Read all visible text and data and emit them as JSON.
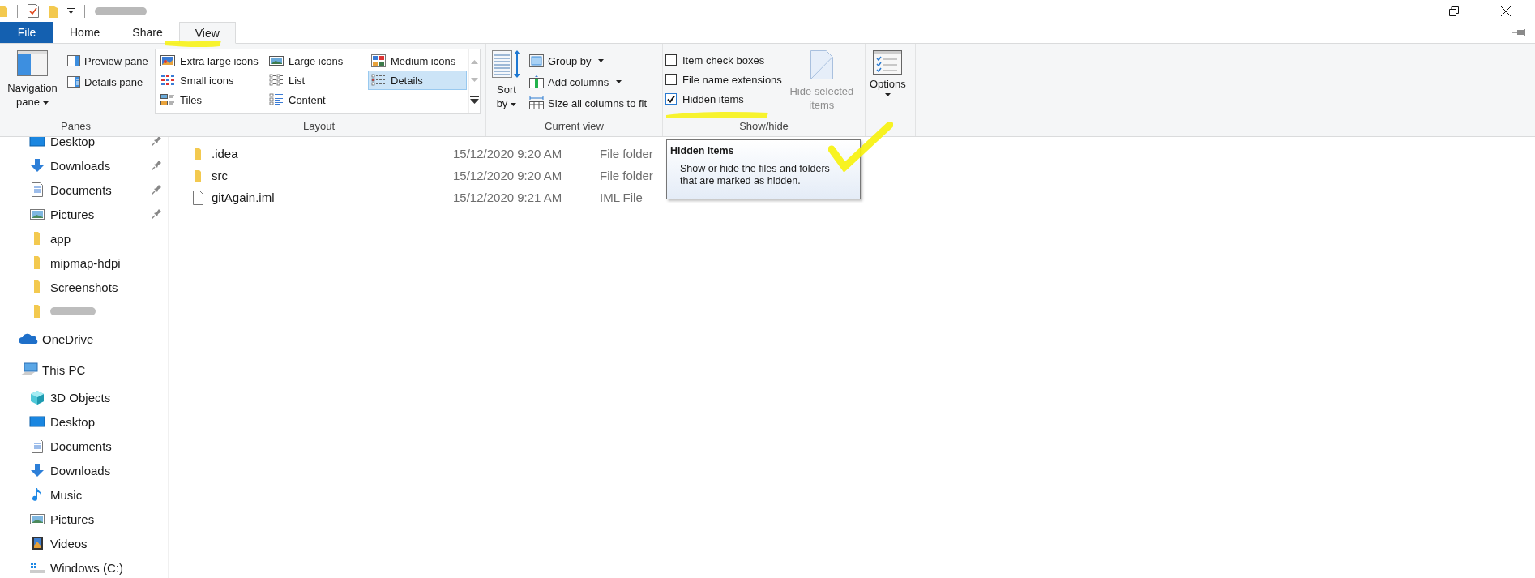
{
  "ribbon_tabs": [
    {
      "label": "File",
      "kind": "file",
      "selected": false
    },
    {
      "label": "Home",
      "kind": "tab",
      "selected": false
    },
    {
      "label": "Share",
      "kind": "tab",
      "selected": false
    },
    {
      "label": "View",
      "kind": "tab",
      "selected": true
    }
  ],
  "panes_group": {
    "title": "Panes",
    "navigation_pane": "Navigation pane",
    "preview_pane": "Preview pane",
    "details_pane": "Details pane"
  },
  "layout_group": {
    "title": "Layout",
    "options": [
      {
        "label": "Extra large icons",
        "kind": "xl",
        "selected": false
      },
      {
        "label": "Large icons",
        "kind": "large",
        "selected": false
      },
      {
        "label": "Medium icons",
        "kind": "medium",
        "selected": false
      },
      {
        "label": "Small icons",
        "kind": "small",
        "selected": false
      },
      {
        "label": "List",
        "kind": "list",
        "selected": false
      },
      {
        "label": "Details",
        "kind": "details",
        "selected": true
      },
      {
        "label": "Tiles",
        "kind": "tiles",
        "selected": false
      },
      {
        "label": "Content",
        "kind": "content",
        "selected": false
      }
    ]
  },
  "current_view_group": {
    "title": "Current view",
    "sort_by": "Sort by",
    "commands": [
      {
        "label": "Group by",
        "kind": "group",
        "dropdown": true
      },
      {
        "label": "Add columns",
        "kind": "columns",
        "dropdown": true
      },
      {
        "label": "Size all columns to fit",
        "kind": "fit",
        "dropdown": false
      }
    ]
  },
  "show_hide_group": {
    "title": "Show/hide",
    "checkboxes": [
      {
        "label": "Item check boxes",
        "checked": false
      },
      {
        "label": "File name extensions",
        "checked": false
      },
      {
        "label": "Hidden items",
        "checked": true
      }
    ],
    "hide_selected": {
      "label": "Hide selected items",
      "disabled": true
    }
  },
  "options_button": {
    "label": "Options"
  },
  "quick_access_items": [
    {
      "label": "Desktop",
      "kind": "desktop",
      "pinned": true
    },
    {
      "label": "Downloads",
      "kind": "downloads",
      "pinned": true
    },
    {
      "label": "Documents",
      "kind": "documents",
      "pinned": true
    },
    {
      "label": "Pictures",
      "kind": "pictures",
      "pinned": true
    },
    {
      "label": "app",
      "kind": "folder",
      "pinned": false
    },
    {
      "label": "mipmap-hdpi",
      "kind": "folder",
      "pinned": false
    },
    {
      "label": "Screenshots",
      "kind": "folder",
      "pinned": false
    },
    {
      "kind": "folder",
      "pinned": false,
      "redacted": true
    }
  ],
  "tree": [
    {
      "label": "OneDrive",
      "kind": "onedrive"
    },
    {
      "label": "This PC",
      "kind": "pc",
      "children": [
        {
          "label": "3D Objects",
          "kind": "objects3d"
        },
        {
          "label": "Desktop",
          "kind": "desktop"
        },
        {
          "label": "Documents",
          "kind": "documents"
        },
        {
          "label": "Downloads",
          "kind": "downloads"
        },
        {
          "label": "Music",
          "kind": "music"
        },
        {
          "label": "Pictures",
          "kind": "pictures"
        },
        {
          "label": "Videos",
          "kind": "videos"
        },
        {
          "label": "Windows (C:)",
          "kind": "drive"
        }
      ]
    }
  ],
  "files": [
    {
      "name": ".idea",
      "modified": "15/12/2020 9:20 AM",
      "type": "File folder",
      "kind": "folder"
    },
    {
      "name": "src",
      "modified": "15/12/2020 9:20 AM",
      "type": "File folder",
      "kind": "folder"
    },
    {
      "name": "gitAgain.iml",
      "modified": "15/12/2020 9:21 AM",
      "type": "IML File",
      "kind": "file"
    }
  ],
  "tooltip": {
    "title": "Hidden items",
    "text": "Show or hide the files and folders that are marked as hidden."
  }
}
